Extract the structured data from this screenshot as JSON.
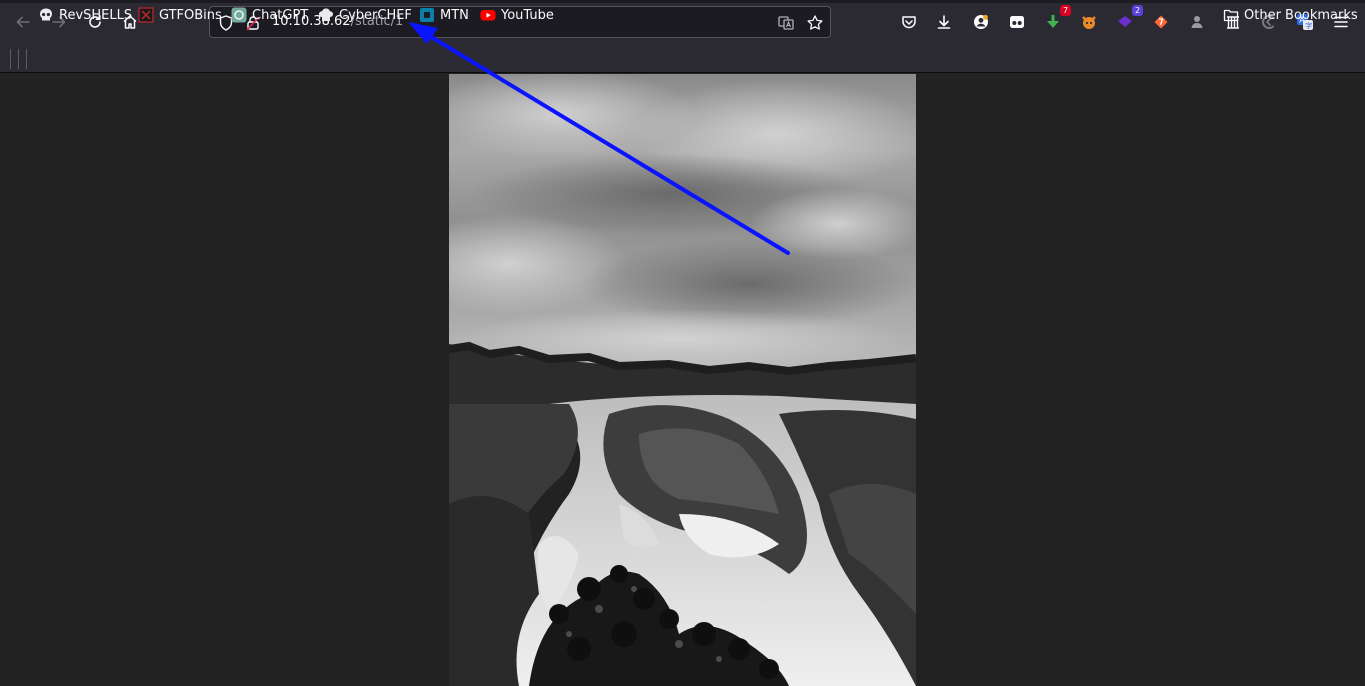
{
  "browser": {
    "url_host": "10.10.38.62",
    "url_path": "/static/1",
    "toolbar_icons": [
      "back-icon",
      "forward-icon",
      "reload-icon",
      "home-icon",
      "pocket-icon",
      "download-icon",
      "account-icon",
      "extension-icon",
      "translate-icon",
      "menu-icon"
    ]
  },
  "extensions": {
    "badge_a": "7",
    "badge_b": "2"
  },
  "bookmarks": {
    "items": [
      {
        "label": "RevSHELLS",
        "icon": "skull-icon"
      },
      {
        "label": "GTFOBins",
        "icon": "gtfobins-icon"
      },
      {
        "label": "ChatGPT",
        "icon": "chatgpt-icon"
      },
      {
        "label": "CyberCHEF",
        "icon": "chef-hat-icon"
      },
      {
        "label": "MTN",
        "icon": "mtn-icon"
      },
      {
        "label": "YouTube",
        "icon": "youtube-icon"
      }
    ],
    "other": "Other Bookmarks"
  },
  "annotation": {
    "arrow_color": "#0a14ff"
  }
}
